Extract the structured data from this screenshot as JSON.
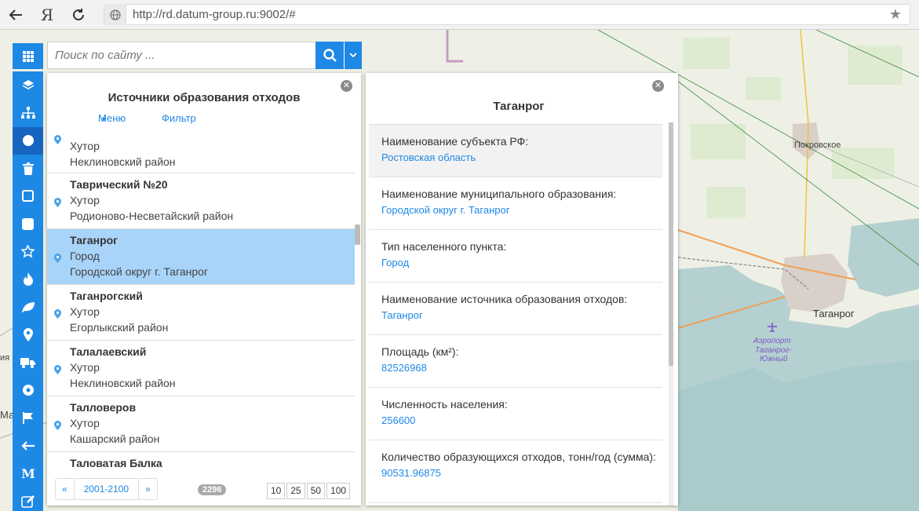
{
  "browser": {
    "back_icon": "back-arrow-icon",
    "yandex_label": "Я",
    "reload_icon": "reload-icon",
    "url": "http://rd.datum-group.ru:9002/#",
    "bookmark_icon": "star-icon"
  },
  "search": {
    "placeholder": "Поиск по сайту ..."
  },
  "toolbar": {
    "items": [
      "apps-grid-icon",
      "layers-icon",
      "hierarchy-icon",
      "circle-icon",
      "trash-icon",
      "square-outline-icon",
      "square-filled-icon",
      "star-outline-icon",
      "fire-icon",
      "leaf-icon",
      "map-pin-icon",
      "truck-icon",
      "disc-icon",
      "flag-icon",
      "arrow-left-icon",
      "metro-m-icon",
      "edit-icon"
    ],
    "active_index": 3
  },
  "sources_panel": {
    "title": "Источники образования отходов",
    "menu_label": "Меню",
    "filter_label": "Фильтр",
    "items": [
      {
        "name": "",
        "type": "Хутор",
        "district": "Неклиновский район"
      },
      {
        "name": "Таврический №20",
        "type": "Хутор",
        "district": "Родионово-Несветайский район"
      },
      {
        "name": "Таганрог",
        "type": "Город",
        "district": "Городской округ г. Таганрог",
        "selected": true
      },
      {
        "name": "Таганрогский",
        "type": "Хутор",
        "district": "Егорлыкский район"
      },
      {
        "name": "Талалаевский",
        "type": "Хутор",
        "district": "Неклиновский район"
      },
      {
        "name": "Талловеров",
        "type": "Хутор",
        "district": "Кашарский район"
      },
      {
        "name": "Таловатая Балка",
        "type": "",
        "district": ""
      }
    ],
    "pager": {
      "prev": "«",
      "range": "2001-2100",
      "next": "»"
    },
    "total_count": "2296",
    "page_sizes": [
      "10",
      "25",
      "50",
      "100"
    ]
  },
  "details_panel": {
    "title": "Таганрог",
    "attributes": [
      {
        "key": "Наименование субъекта РФ:",
        "value": "Ростовская область"
      },
      {
        "key": "Наименование муниципального образования:",
        "value": "Городской округ г. Таганрог"
      },
      {
        "key": "Тип населенного пункта:",
        "value": "Город"
      },
      {
        "key": "Наименование источника образования отходов:",
        "value": "Таганрог"
      },
      {
        "key": "Площадь (км²):",
        "value": "82526968"
      },
      {
        "key": "Численность населения:",
        "value": "256600"
      },
      {
        "key": "Количество образующихся отходов, тонн/год (сумма):",
        "value": "90531.96875"
      }
    ]
  },
  "map": {
    "labels": {
      "pokrovskoe": "Покровское",
      "taganrog": "Таганрог",
      "airport_1": "Аэропорт",
      "airport_2": "Таганрог-",
      "airport_3": "Южный",
      "left_edge_1": "ия",
      "left_edge_2": "Ма"
    },
    "colors": {
      "sea": "#b5d0d0",
      "land": "#eef0e6",
      "urban": "#d9d0c9"
    }
  }
}
